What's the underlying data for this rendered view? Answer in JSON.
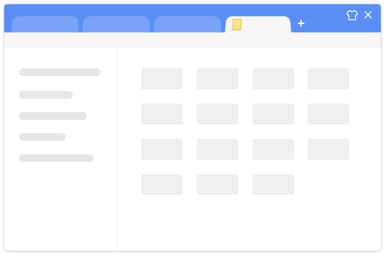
{
  "colors": {
    "accent": "#5b8ef5",
    "tab_inactive": "#7aa3f7",
    "tab_active": "#f6f6f6",
    "placeholder": "#e6e6e6",
    "tile": "#efefef"
  },
  "titlebar": {
    "tabs": [
      {
        "label": "",
        "active": false
      },
      {
        "label": "",
        "active": false
      },
      {
        "label": "",
        "active": false
      },
      {
        "label": "",
        "active": true,
        "icon": "document-icon"
      }
    ],
    "new_tab_label": "+",
    "controls": [
      {
        "icon": "tshirt-icon",
        "purpose": "skin"
      },
      {
        "icon": "close-icon",
        "purpose": "close"
      }
    ]
  },
  "sidebar": {
    "items": [
      {
        "label": ""
      },
      {
        "label": ""
      },
      {
        "label": ""
      },
      {
        "label": ""
      },
      {
        "label": ""
      }
    ]
  },
  "main": {
    "tiles": [
      {
        "label": ""
      },
      {
        "label": ""
      },
      {
        "label": ""
      },
      {
        "label": ""
      },
      {
        "label": ""
      },
      {
        "label": ""
      },
      {
        "label": ""
      },
      {
        "label": ""
      },
      {
        "label": ""
      },
      {
        "label": ""
      },
      {
        "label": ""
      },
      {
        "label": ""
      },
      {
        "label": ""
      },
      {
        "label": ""
      },
      {
        "label": ""
      }
    ]
  }
}
